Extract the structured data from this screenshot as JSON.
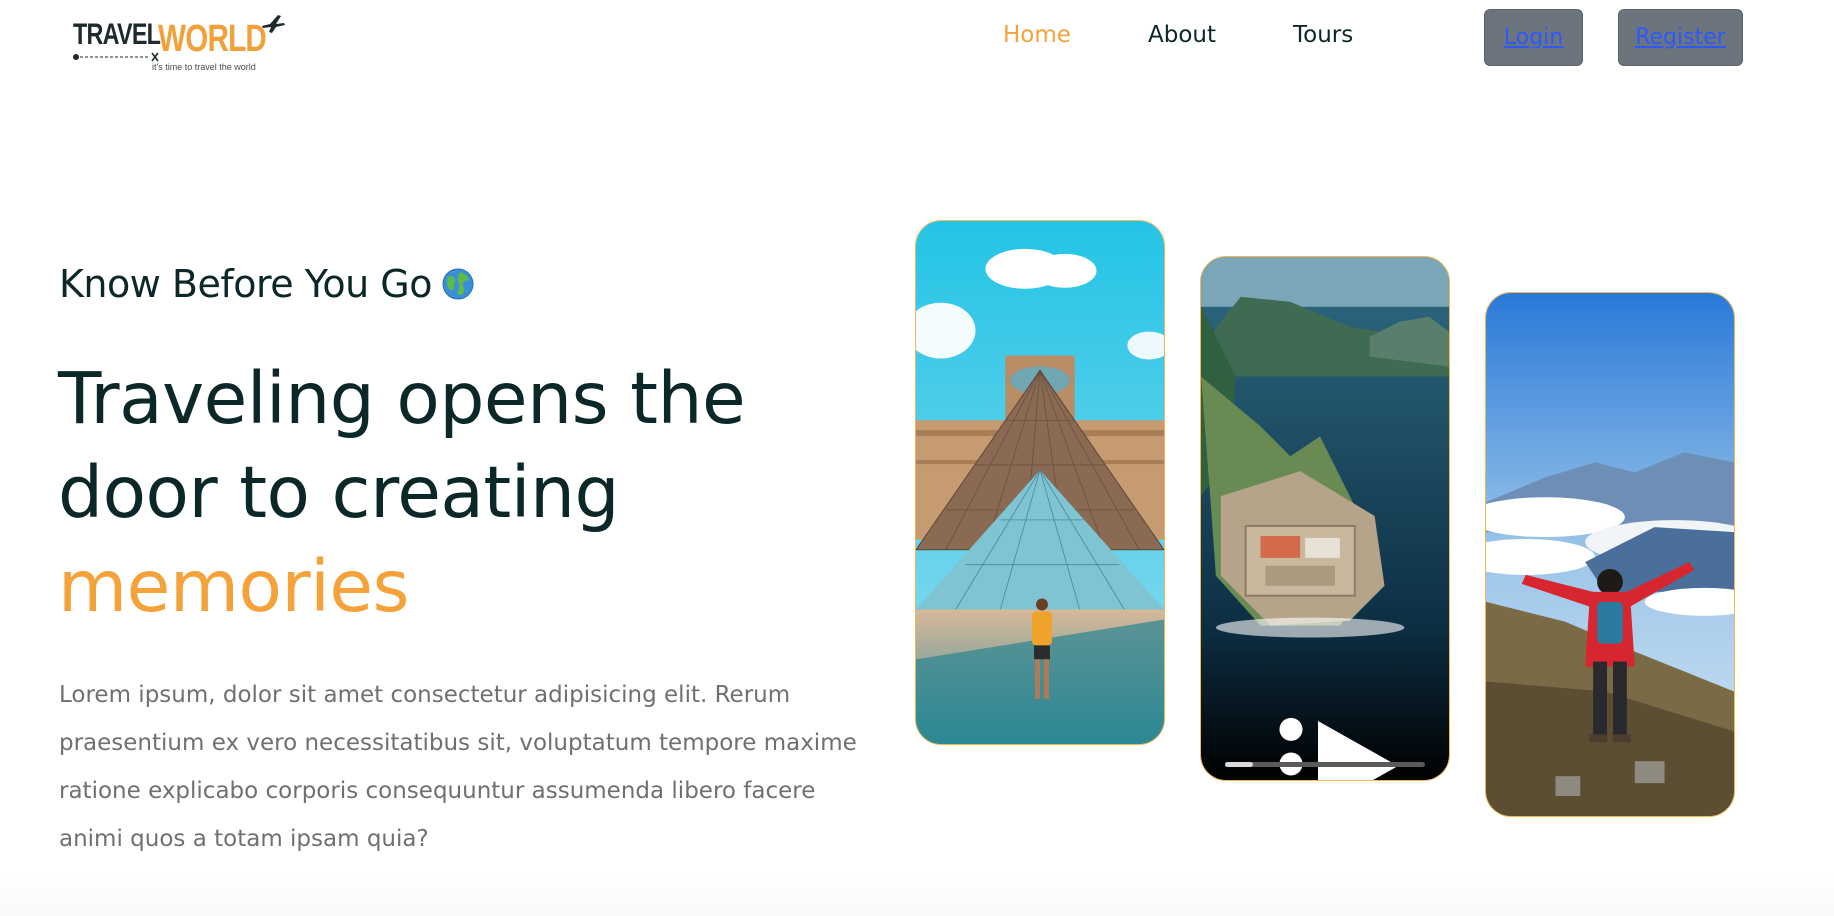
{
  "header": {
    "logo": {
      "word1": "TRAVEL",
      "word2": "WORLD",
      "tagline": "it's time to travel the world",
      "icon": "airplane-icon"
    },
    "nav": [
      {
        "label": "Home",
        "active": true
      },
      {
        "label": "About",
        "active": false
      },
      {
        "label": "Tours",
        "active": false
      }
    ],
    "login_label": "Login",
    "register_label": "Register"
  },
  "hero": {
    "subtitle": "Know Before You Go",
    "subtitle_icon": "globe-icon",
    "headline_line1": "Traveling opens the",
    "headline_line2": "door to creating",
    "headline_accent": "memories",
    "description": "Lorem ipsum, dolor sit amet consectetur adipisicing elit. Rerum praesentium ex vero necessitatibus sit, voluptatum tempore maxime ratione explicabo corporis consequuntur assumenda libero facere animi quos a totam ipsam quia?",
    "video": {
      "progress": 0.14
    }
  },
  "colors": {
    "accent": "#f5a23b",
    "heading": "#0b2727",
    "text": "#6e7074",
    "button_bg": "#6c757d",
    "link": "#2b59ff"
  }
}
